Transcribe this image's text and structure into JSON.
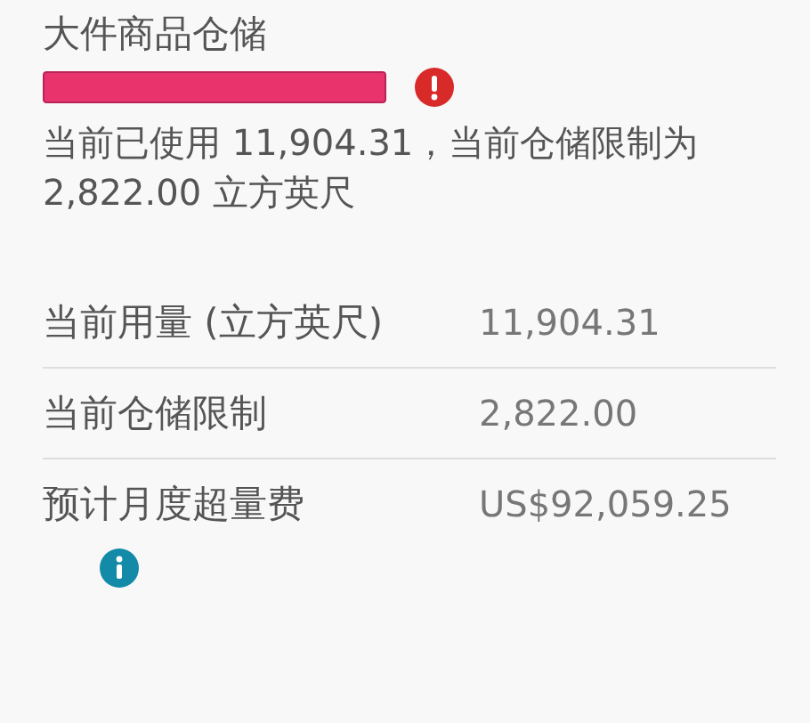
{
  "title": "大件商品仓储",
  "usage_bar": {
    "level": 1,
    "over_limit": true
  },
  "description": "当前已使用 11,904.31，当前仓储限制为 2,822.00 立方英尺",
  "rows": [
    {
      "label": "当前用量 (立方英尺)",
      "value": "11,904.31",
      "info": false
    },
    {
      "label": "当前仓储限制",
      "value": "2,822.00",
      "info": false
    },
    {
      "label": "预计月度超量费",
      "value": "US$92,059.25",
      "info": true
    }
  ]
}
